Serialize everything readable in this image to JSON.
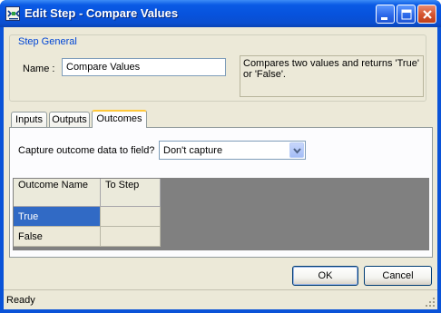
{
  "window": {
    "title": "Edit Step - Compare Values"
  },
  "step_general": {
    "group_title": "Step General",
    "name_label": "Name :",
    "name_value": "Compare Values",
    "description": "Compares two values and returns 'True' or 'False'."
  },
  "tabs": [
    {
      "label": "Inputs"
    },
    {
      "label": "Outputs"
    },
    {
      "label": "Outcomes",
      "active": true
    }
  ],
  "outcomes": {
    "capture_label": "Capture outcome data to field?",
    "capture_value": "Don't capture",
    "columns": [
      "Outcome Name",
      "To Step"
    ],
    "rows": [
      {
        "outcome_name": "True",
        "to_step": "",
        "selected": true
      },
      {
        "outcome_name": "False",
        "to_step": "",
        "selected": false
      }
    ]
  },
  "buttons": {
    "ok": "OK",
    "cancel": "Cancel"
  },
  "status": {
    "text": "Ready"
  },
  "colors": {
    "titlebar": "#0a5ae5",
    "selection": "#316ac5",
    "group_title": "#0046d5",
    "grid_background": "#808080"
  }
}
